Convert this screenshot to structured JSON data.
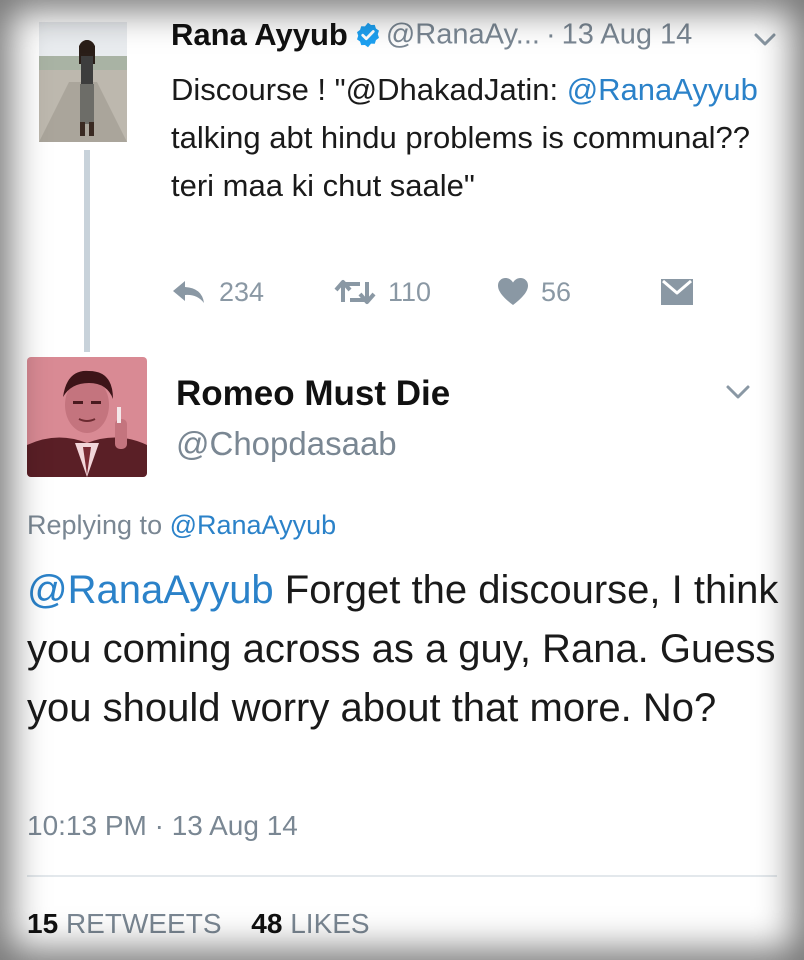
{
  "parent_tweet": {
    "author_name": "Rana Ayyub",
    "handle": "@RanaAy...",
    "separator": "·",
    "date": "13 Aug 14",
    "text_prefix": "Discourse ! \"@DhakadJatin: ",
    "text_mention": "@RanaAyyub",
    "text_rest": " talking abt hindu problems is communal??teri maa ki chut saale\"",
    "actions": {
      "reply_count": "234",
      "retweet_count": "110",
      "like_count": "56"
    }
  },
  "reply_tweet": {
    "author_name": "Romeo Must Die",
    "handle": "@Chopdasaab",
    "replying_to_label": "Replying to ",
    "replying_to_handle": "@RanaAyyub",
    "text_mention": "@RanaAyyub",
    "text_rest": " Forget the discourse, I think you coming across as a guy, Rana. Guess you should worry about that more. No?",
    "timestamp": "10:13 PM · 13 Aug 14",
    "retweets_count": "15",
    "retweets_label": "RETWEETS",
    "likes_count": "48",
    "likes_label": "LIKES"
  },
  "colors": {
    "link": "#2b82c9",
    "muted": "#7a8793",
    "verified": "#1da1f2",
    "thread_line": "#c8d2da"
  },
  "icons": [
    "verified-badge-icon",
    "chevron-down-icon",
    "reply-icon",
    "retweet-icon",
    "heart-icon",
    "direct-message-icon"
  ]
}
